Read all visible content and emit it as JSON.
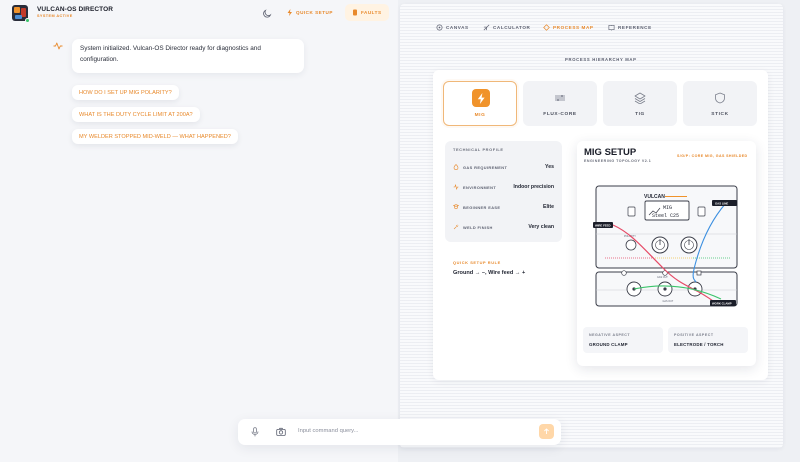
{
  "app": {
    "title": "VULCAN-OS DIRECTOR",
    "status": "SYSTEM ACTIVE"
  },
  "toolbar": {
    "quick_setup_label": "QUICK SETUP",
    "faults_label": "FAULTS"
  },
  "chat": {
    "system_message": "System initialized. Vulcan-OS Director ready for diagnostics and configuration.",
    "suggestions": [
      "HOW DO I SET UP MIG POLARITY?",
      "WHAT IS THE DUTY CYCLE LIMIT AT 200A?",
      "MY WELDER STOPPED MID-WELD — WHAT HAPPENED?"
    ]
  },
  "command": {
    "placeholder": "Input command query..."
  },
  "nav": {
    "items": [
      "CANVAS",
      "CALCULATOR",
      "PROCESS MAP",
      "REFERENCE"
    ],
    "active": "PROCESS MAP"
  },
  "hierarchy": {
    "title": "PROCESS HIERARCHY MAP",
    "processes": [
      "MIG",
      "FLUX-CORE",
      "TIG",
      "STICK"
    ],
    "active": "MIG"
  },
  "profile": {
    "title": "TECHNICAL PROFILE",
    "rows": [
      {
        "key": "GAS REQUIREMENT",
        "value": "Yes",
        "icon": "gas-icon"
      },
      {
        "key": "ENVIRONMENT",
        "value": "Indoor precision",
        "icon": "environment-icon"
      },
      {
        "key": "BEGINNER EASE",
        "value": "Elite",
        "icon": "beginner-icon"
      },
      {
        "key": "WELD FINISH",
        "value": "Very clean",
        "icon": "finish-icon"
      }
    ]
  },
  "quick_rule": {
    "title": "QUICK SETUP RULE",
    "text": "Ground → –, Wire feed → +"
  },
  "setup": {
    "title": "MIG SETUP",
    "subtitle": "ENGINEERING TOPOLOGY V2.1",
    "badge": "S/G/P: CORE MIG, GAS SHIELDED",
    "diagram": {
      "brand": "VULCAN",
      "display_line1": "MIG",
      "display_line2": "Steel C25",
      "left_tag": "WIRE FEED",
      "right_tag": "GAS LINE",
      "bottom_tag": "WORK CLAMP",
      "upper_label": "POLARITY",
      "lower_label": "GAS OUT"
    },
    "negative": {
      "key": "NEGATIVE ASPECT",
      "value": "GROUND CLAMP"
    },
    "positive": {
      "key": "POSITIVE ASPECT",
      "value": "ELECTRODE / TORCH"
    }
  },
  "colors": {
    "accent": "#f0932b",
    "positive_lead": "#e64a66",
    "gas_lead": "#3b8fe0",
    "ground_lead": "#3cc46b"
  }
}
